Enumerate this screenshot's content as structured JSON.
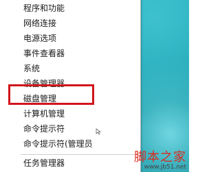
{
  "menu": {
    "items": [
      {
        "label": "程序和功能"
      },
      {
        "label": "网络连接"
      },
      {
        "label": "电源选项"
      },
      {
        "label": "事件查看器"
      },
      {
        "label": "系统"
      },
      {
        "label": "设备管理器"
      },
      {
        "label": "磁盘管理"
      },
      {
        "label": "计算机管理"
      },
      {
        "label": "命令提示符"
      },
      {
        "label": "命令提示符(管理员"
      },
      {
        "label": "任务管理器"
      }
    ]
  },
  "highlight": {
    "target": "磁盘管理",
    "color": "#d0141a"
  },
  "watermark": {
    "title": "脚本之家",
    "url": "www.jb51.net"
  },
  "colors": {
    "desktop": "#21a7b6",
    "menu_bg": "#ffffff"
  }
}
